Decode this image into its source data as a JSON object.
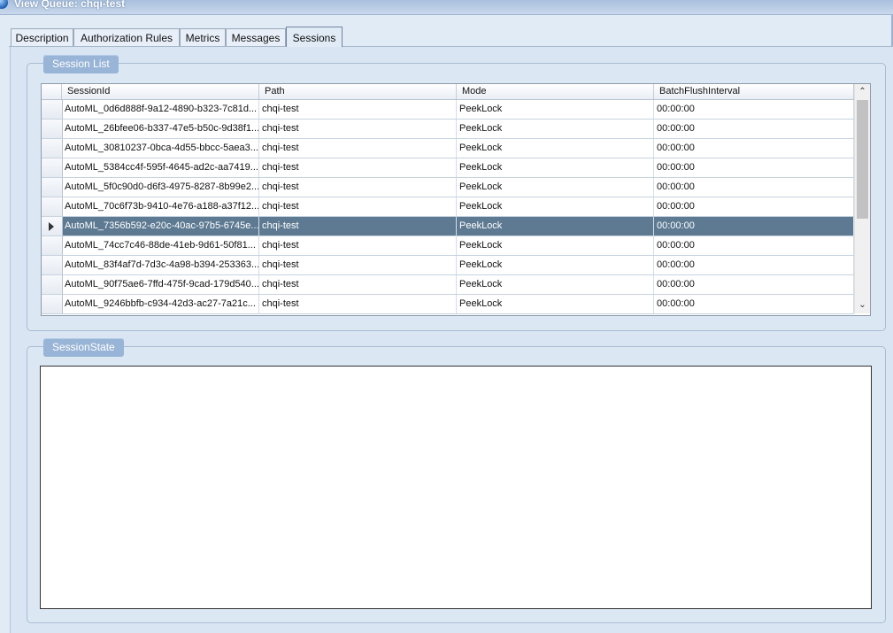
{
  "window": {
    "title": "View Queue: chqi-test"
  },
  "tabs": [
    {
      "label": "Description",
      "active": false
    },
    {
      "label": "Authorization Rules",
      "active": false
    },
    {
      "label": "Metrics",
      "active": false
    },
    {
      "label": "Messages",
      "active": false
    },
    {
      "label": "Sessions",
      "active": true
    }
  ],
  "session_list": {
    "legend": "Session List",
    "columns": [
      "SessionId",
      "Path",
      "Mode",
      "BatchFlushInterval"
    ],
    "selected_row": 6,
    "rows": [
      [
        "AutoML_0d6d888f-9a12-4890-b323-7c81d...",
        "chqi-test",
        "PeekLock",
        "00:00:00"
      ],
      [
        "AutoML_26bfee06-b337-47e5-b50c-9d38f1...",
        "chqi-test",
        "PeekLock",
        "00:00:00"
      ],
      [
        "AutoML_30810237-0bca-4d55-bbcc-5aea3...",
        "chqi-test",
        "PeekLock",
        "00:00:00"
      ],
      [
        "AutoML_5384cc4f-595f-4645-ad2c-aa7419...",
        "chqi-test",
        "PeekLock",
        "00:00:00"
      ],
      [
        "AutoML_5f0c90d0-d6f3-4975-8287-8b99e2...",
        "chqi-test",
        "PeekLock",
        "00:00:00"
      ],
      [
        "AutoML_70c6f73b-9410-4e76-a188-a37f12...",
        "chqi-test",
        "PeekLock",
        "00:00:00"
      ],
      [
        "AutoML_7356b592-e20c-40ac-97b5-6745e...",
        "chqi-test",
        "PeekLock",
        "00:00:00"
      ],
      [
        "AutoML_74cc7c46-88de-41eb-9d61-50f81...",
        "chqi-test",
        "PeekLock",
        "00:00:00"
      ],
      [
        "AutoML_83f4af7d-7d3c-4a98-b394-253363...",
        "chqi-test",
        "PeekLock",
        "00:00:00"
      ],
      [
        "AutoML_90f75ae6-7ffd-475f-9cad-179d540...",
        "chqi-test",
        "PeekLock",
        "00:00:00"
      ],
      [
        "AutoML_9246bbfb-c934-42d3-ac27-7a21c...",
        "chqi-test",
        "PeekLock",
        "00:00:00"
      ]
    ]
  },
  "session_state": {
    "legend": "SessionState",
    "value": ""
  },
  "colors": {
    "selected_row": "#5d7a92",
    "legend_bg": "#98b4d6",
    "window_bg": "#e1ebf6"
  },
  "icons": {
    "title": "globe-icon",
    "scroll_up": "chevron-up-icon",
    "scroll_down": "chevron-down-icon",
    "row_pointer": "row-pointer-icon"
  }
}
